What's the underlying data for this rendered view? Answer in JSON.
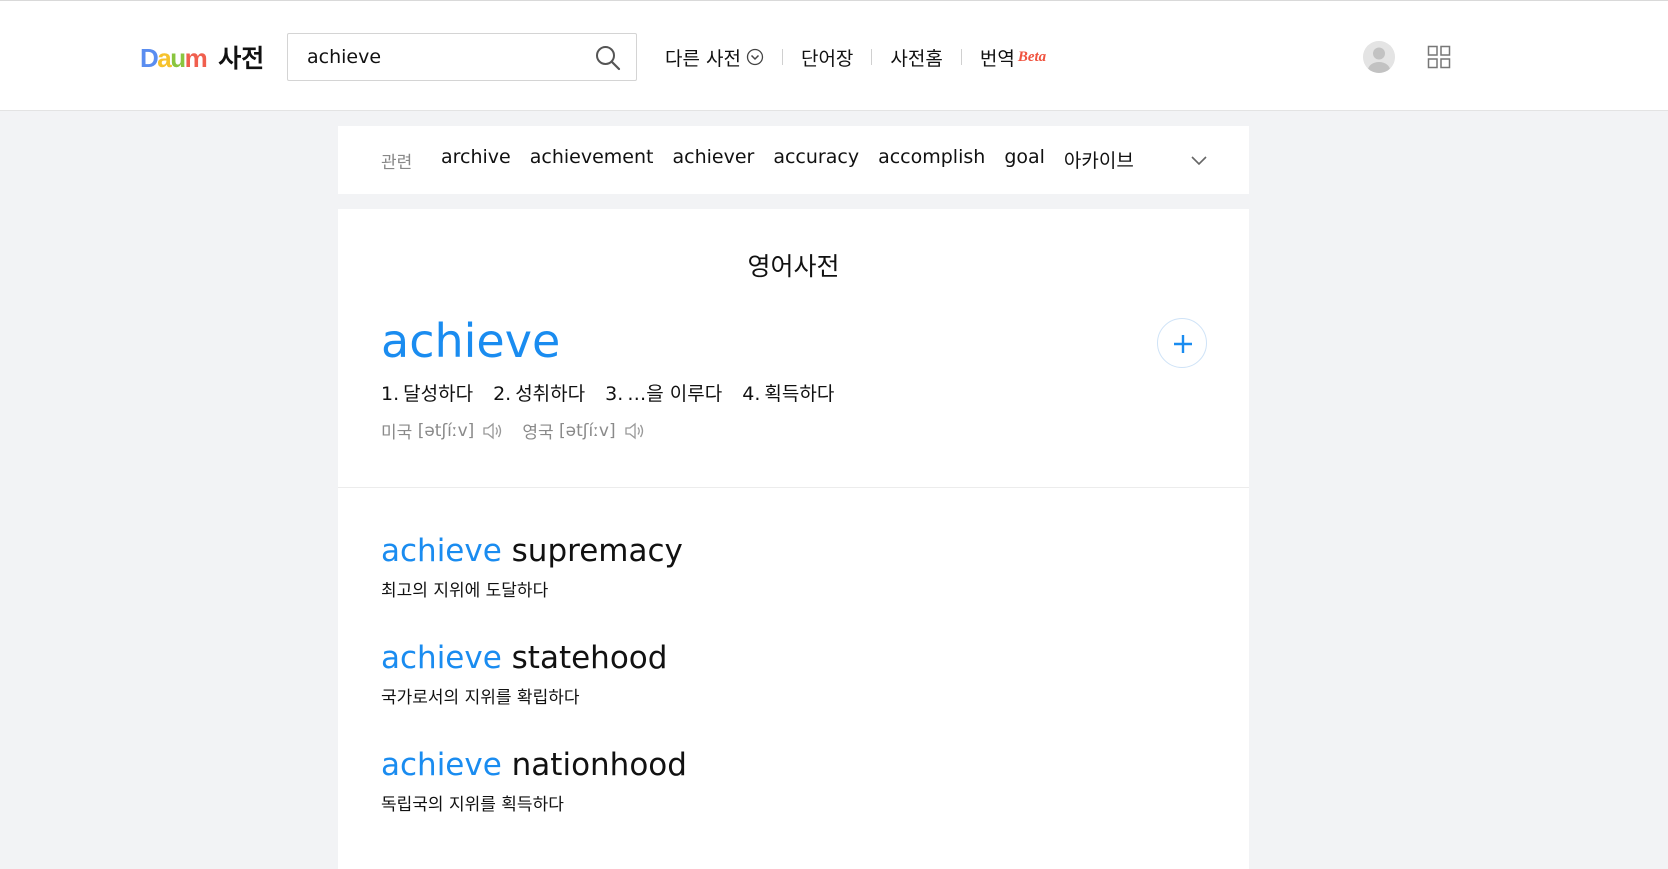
{
  "header": {
    "logo_letters": {
      "d": "D",
      "a": "a",
      "u": "u",
      "m": "m"
    },
    "service_name": "사전",
    "search": {
      "value": "achieve",
      "placeholder": ""
    },
    "nav": {
      "other_dict": "다른 사전",
      "wordbook": "단어장",
      "dict_home": "사전홈",
      "translate": "번역",
      "translate_badge": "Beta"
    }
  },
  "related": {
    "label": "관련",
    "words": [
      "archive",
      "achievement",
      "achiever",
      "accuracy",
      "accomplish",
      "goal",
      "아카이브"
    ]
  },
  "dictionary": {
    "title": "영어사전",
    "word": "achieve",
    "meanings": [
      {
        "num": "1.",
        "text": "달성하다"
      },
      {
        "num": "2.",
        "text": "성취하다"
      },
      {
        "num": "3.",
        "text": "…을 이루다"
      },
      {
        "num": "4.",
        "text": "획득하다"
      }
    ],
    "pronunciations": [
      {
        "region": "미국",
        "ipa": "[ətʃíːv]"
      },
      {
        "region": "영국",
        "ipa": "[ətʃíːv]"
      }
    ]
  },
  "examples": [
    {
      "keyword": "achieve",
      "rest": "supremacy",
      "translation": "최고의 지위에 도달하다"
    },
    {
      "keyword": "achieve",
      "rest": "statehood",
      "translation": "국가로서의 지위를 확립하다"
    },
    {
      "keyword": "achieve",
      "rest": "nationhood",
      "translation": "독립국의 지위를 획득하다"
    }
  ],
  "colors": {
    "accent_blue": "#1a8cf0",
    "highlight_yellow": "#ffef00",
    "beta_red": "#f0523e"
  },
  "icons": {
    "search": "search-icon",
    "chevron": "chevron-down-icon",
    "avatar": "user-avatar-icon",
    "apps": "apps-grid-icon",
    "add": "plus-icon",
    "speaker": "speaker-icon"
  }
}
